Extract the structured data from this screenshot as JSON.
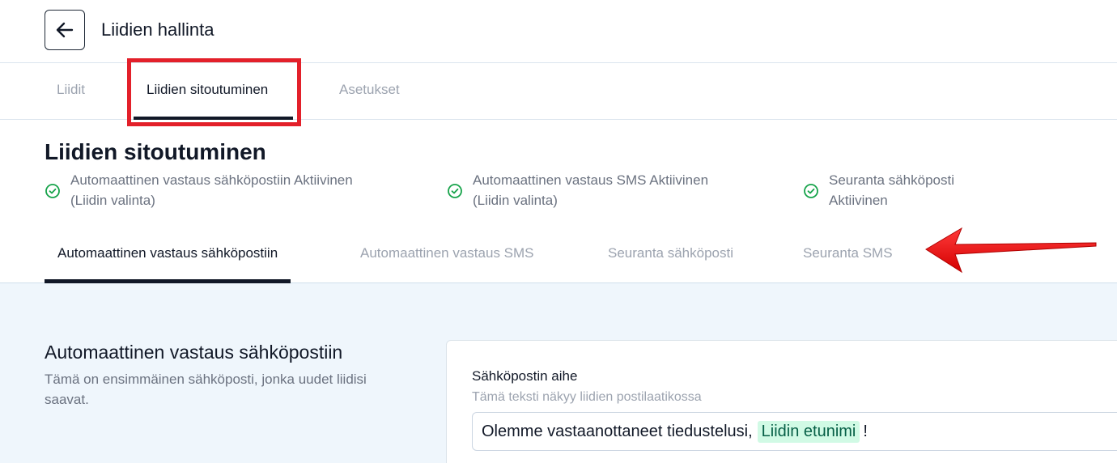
{
  "header": {
    "title": "Liidien hallinta",
    "back_icon": "arrow-left-icon"
  },
  "main_tabs": [
    {
      "label": "Liidit",
      "active": false
    },
    {
      "label": "Liidien sitoutuminen",
      "active": true
    },
    {
      "label": "Asetukset",
      "active": false
    }
  ],
  "section": {
    "title": "Liidien sitoutuminen",
    "statuses": [
      {
        "line1": "Automaattinen vastaus sähköpostiin Aktiivinen",
        "line2": "(Liidin valinta)",
        "icon": "check-circle-icon"
      },
      {
        "line1": "Automaattinen vastaus SMS Aktiivinen",
        "line2": "(Liidin valinta)",
        "icon": "check-circle-icon"
      },
      {
        "line1": "Seuranta sähköposti",
        "line2": "Aktiivinen",
        "icon": "check-circle-icon"
      }
    ]
  },
  "sub_tabs": [
    {
      "label": "Automaattinen vastaus sähköpostiin",
      "active": true
    },
    {
      "label": "Automaattinen vastaus SMS",
      "active": false
    },
    {
      "label": "Seuranta sähköposti",
      "active": false
    },
    {
      "label": "Seuranta SMS",
      "active": false
    }
  ],
  "content": {
    "title": "Automaattinen vastaus sähköpostiin",
    "description": "Tämä on ensimmäinen sähköposti, jonka uudet liidisi saavat."
  },
  "email_subject": {
    "label": "Sähköpostin aihe",
    "help": "Tämä teksti näkyy liidien postilaatikossa",
    "text_before": "Olemme vastaanottaneet tiedustelusi,",
    "variable_tag": "Liidin etunimi",
    "text_after": "!"
  },
  "colors": {
    "accent_dark": "#111827",
    "highlight_red": "#e3202a",
    "success_green": "#16a34a",
    "content_bg": "#eff6fc",
    "tag_bg": "#d1fae5"
  }
}
